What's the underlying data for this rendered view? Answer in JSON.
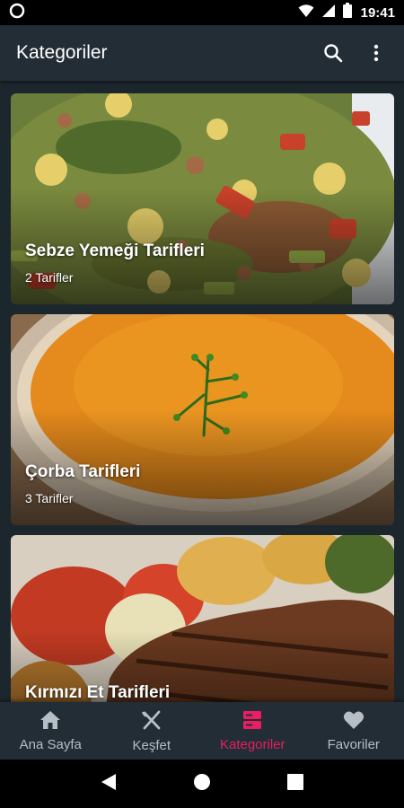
{
  "status_bar": {
    "time": "19:41",
    "icons": [
      "circle-icon",
      "wifi-icon",
      "signal-icon",
      "battery-icon"
    ]
  },
  "app_bar": {
    "title": "Kategoriler",
    "actions": [
      "search-icon",
      "more-vert-icon"
    ]
  },
  "categories": [
    {
      "title": "Sebze Yemeği Tarifleri",
      "count": "2 Tarifler",
      "image": "vegetable-stew"
    },
    {
      "title": "Çorba Tarifleri",
      "count": "3 Tarifler",
      "image": "lentil-soup"
    },
    {
      "title": "Kırmızı Et Tarifleri",
      "count": "",
      "image": "grilled-steak"
    }
  ],
  "bottom_nav": {
    "items": [
      {
        "label": "Ana Sayfa",
        "icon": "home-icon",
        "active": false
      },
      {
        "label": "Keşfet",
        "icon": "fork-knife-icon",
        "active": false
      },
      {
        "label": "Kategoriler",
        "icon": "categories-icon",
        "active": true
      },
      {
        "label": "Favoriler",
        "icon": "heart-icon",
        "active": false
      }
    ],
    "active_color": "#e91e63",
    "inactive_color": "#b7bec4"
  },
  "system_nav": [
    "back-icon",
    "home-circle-icon",
    "recents-icon"
  ],
  "colors": {
    "background": "#1c262d",
    "app_bar": "#222d35",
    "accent": "#e91e63"
  }
}
